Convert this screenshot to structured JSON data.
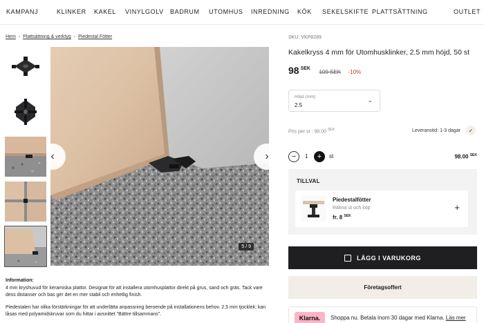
{
  "nav": {
    "items": [
      "KAMPANJ",
      "KLINKER",
      "KAKEL",
      "VINYLGOLV",
      "BADRUM",
      "UTOMHUS",
      "INREDNING",
      "KÖK",
      "SEKELSKIFTE",
      "PLATTSÄTTNING",
      "OUTLET"
    ]
  },
  "breadcrumb": [
    "Hem",
    "Plattsättning & verktyg",
    "Piedestal Fötter"
  ],
  "gallery": {
    "counter": "5 / 9",
    "prev_icon": "chevron-left-icon",
    "next_icon": "chevron-right-icon"
  },
  "description": {
    "heading": "Information:",
    "p1": "4 mm kryshuvud för keramiska plattor. Designat för att installera utomhusplattor direkt på grus, sand och gräs. Tack vare dess distanser och bas ger det en mer stabil och enhetlig finish.",
    "p2": "Piedestalen har olika förstärkningar för att underlätta anpassning beroende på installationens behov. 2,5 mm tjocklek; kan låsas med polyamidskruvar som du hittar i avsnittet \"Bättre tillsammans\"."
  },
  "product": {
    "sku": "SKU: VKP8289",
    "title": "Kakelkryss 4 mm för Utomhusklinker, 2.5 mm höjd, 50 st",
    "price": "98",
    "currency": "SEK",
    "old_price": "109 SEK",
    "discount": "-10%"
  },
  "height_select": {
    "label": "Höjd (mm)",
    "value": "2.5"
  },
  "per_st": {
    "label": "Pris per st :",
    "value": "98.00",
    "currency": "SEK"
  },
  "delivery": {
    "label": "Leveranstid: 1-3 dagar"
  },
  "quantity": {
    "value": "1",
    "unit": "st",
    "total": "98.00",
    "currency": "SEK"
  },
  "tillval": {
    "heading": "TILLVAL",
    "item": {
      "name": "Piedestalfötter",
      "sub": "Räkna ut och köp",
      "price_prefix": "fr. 8",
      "currency": "SEK"
    }
  },
  "buttons": {
    "cart": "LÄGG I VARUKORG",
    "offer": "Företagsoffert"
  },
  "klarna": {
    "badge": "Klarna.",
    "text": "Shoppa nu. Betala inom 30 dagar med Klarna.",
    "more": "Läs mer"
  }
}
